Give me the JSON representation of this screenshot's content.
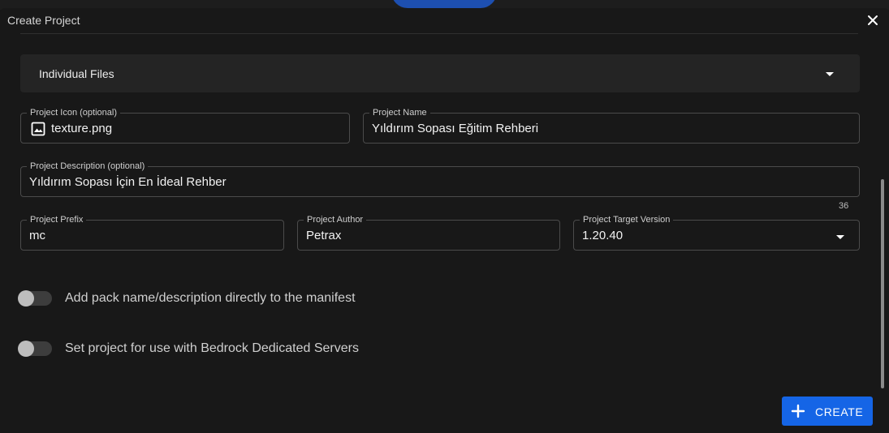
{
  "dialog": {
    "title": "Create Project",
    "close_icon": "close-icon"
  },
  "accordion": {
    "label": "Individual Files",
    "icon": "caret-down-icon"
  },
  "fields": {
    "icon": {
      "label": "Project Icon (optional)",
      "value": "texture.png",
      "icon": "image-icon"
    },
    "name": {
      "label": "Project Name",
      "value": "Yıldırım Sopası Eğitim Rehberi"
    },
    "description": {
      "label": "Project Description (optional)",
      "value": "Yıldırım Sopası İçin En İdeal Rehber",
      "counter": "36"
    },
    "prefix": {
      "label": "Project Prefix",
      "value": "mc"
    },
    "author": {
      "label": "Project Author",
      "value": "Petrax"
    },
    "target_version": {
      "label": "Project Target Version",
      "value": "1.20.40",
      "icon": "caret-down-icon"
    }
  },
  "toggles": [
    {
      "label": "Add pack name/description directly to the manifest",
      "on": false
    },
    {
      "label": "Set project for use with Bedrock Dedicated Servers",
      "on": false
    }
  ],
  "create_button": {
    "label": "CREATE",
    "icon": "plus-icon",
    "color": "#1565e6"
  }
}
